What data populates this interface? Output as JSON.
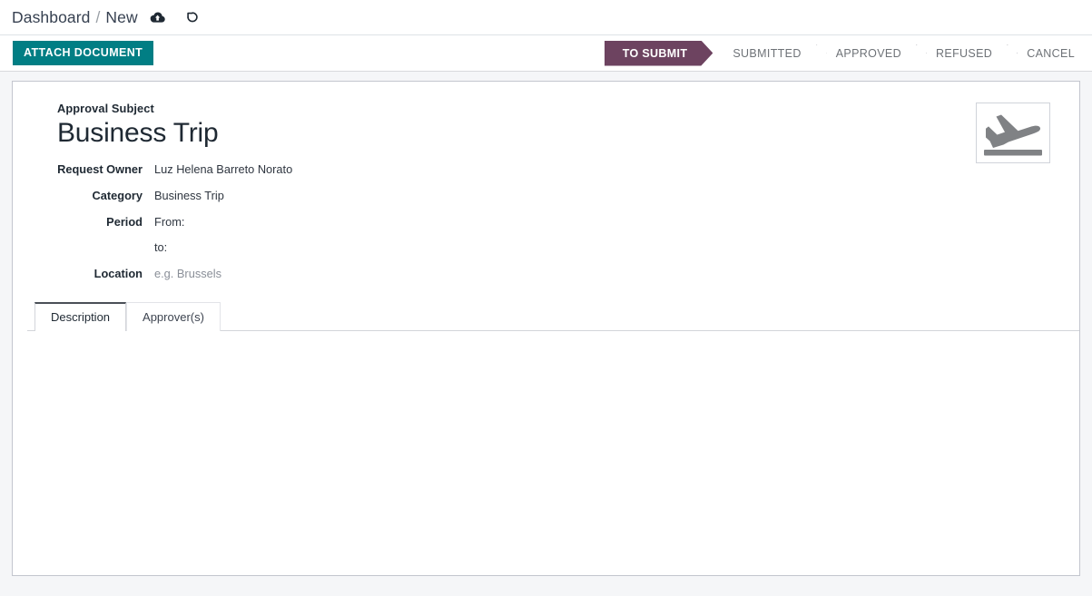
{
  "breadcrumb": {
    "root": "Dashboard",
    "separator": "/",
    "current": "New",
    "save_icon": "cloud-upload-icon",
    "discard_icon": "undo-arrow-icon"
  },
  "control_panel": {
    "attach_button": "ATTACH DOCUMENT",
    "statusbar": [
      {
        "label": "TO SUBMIT",
        "active": true
      },
      {
        "label": "SUBMITTED",
        "active": false
      },
      {
        "label": "APPROVED",
        "active": false
      },
      {
        "label": "REFUSED",
        "active": false
      },
      {
        "label": "CANCEL",
        "active": false
      }
    ]
  },
  "form": {
    "subject_label": "Approval Subject",
    "subject_value": "Business Trip",
    "image_icon": "airplane-takeoff-icon",
    "fields": [
      {
        "label": "Request Owner",
        "value": "Luz Helena Barreto Norato"
      },
      {
        "label": "Category",
        "value": "Business Trip"
      }
    ],
    "period": {
      "label": "Period",
      "from_text": "From:",
      "to_text": "to:"
    },
    "location": {
      "label": "Location",
      "placeholder": "e.g. Brussels"
    }
  },
  "notebook": {
    "tabs": [
      {
        "label": "Description",
        "active": true
      },
      {
        "label": "Approver(s)",
        "active": false
      }
    ],
    "content": ""
  },
  "colors": {
    "primary": "#6d4360",
    "accent_button": "#017e84",
    "page_background": "#f5f6f8",
    "text": "#1f2933",
    "muted_text": "#8a8f98"
  }
}
